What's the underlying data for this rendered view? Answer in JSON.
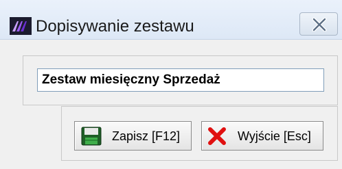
{
  "window": {
    "title": "Dopisywanie zestawu",
    "app_icon": "logo-icon",
    "close_icon": "close-icon"
  },
  "form": {
    "name_value": "Zestaw miesięczny Sprzedaż"
  },
  "buttons": {
    "save_label": "Zapisz  [F12]",
    "save_icon": "save-icon",
    "exit_label": "Wyjście  [Esc]",
    "exit_icon": "cross-icon"
  },
  "colors": {
    "save_icon": "#2e7d32",
    "exit_icon": "#e01010",
    "logo": "#4a1a8c"
  }
}
